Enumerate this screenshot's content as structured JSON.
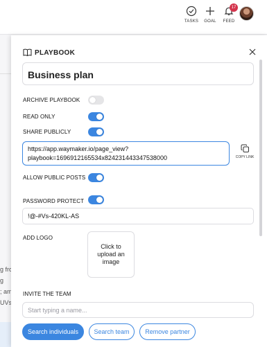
{
  "topbar": {
    "tasks_label": "TASKS",
    "goal_label": "GOAL",
    "feed_label": "FEED",
    "feed_badge": "17"
  },
  "background": {
    "fragments": [
      "g fro",
      "g",
      "; am",
      "UVs)"
    ]
  },
  "panel": {
    "title": "PLAYBOOK",
    "name_value": "Business plan",
    "rows": {
      "archive": {
        "label": "ARCHIVE PLAYBOOK",
        "on": false
      },
      "read_only": {
        "label": "READ ONLY",
        "on": true
      },
      "share_publicly": {
        "label": "SHARE PUBLICLY",
        "on": true
      },
      "allow_public_posts": {
        "label": "ALLOW PUBLIC POSTS",
        "on": true
      },
      "password_protect": {
        "label": "PASSWORD PROTECT",
        "on": true
      }
    },
    "share_url_line1": "https://app.waymaker.io/page_view?",
    "share_url_line2": "playbook=1696912165534x824231443347538000",
    "copy_link_label": "COPY LINK",
    "password_value": "!@-#Vs-420KL-AS",
    "add_logo_label": "ADD LOGO",
    "upload_image_label": "Click to upload an image",
    "invite_label": "INVITE THE TEAM",
    "invite_placeholder": "Start typing a name...",
    "buttons": {
      "search_individuals": "Search individuals",
      "search_team": "Search team",
      "remove_partner": "Remove partner"
    }
  },
  "colors": {
    "accent": "#3b86e0",
    "badge": "#d3344c",
    "toggle_off": "#e5e5e7"
  },
  "icons": [
    "check-circle-icon",
    "plus-icon",
    "bell-icon",
    "book-icon",
    "close-icon",
    "copy-icon"
  ]
}
